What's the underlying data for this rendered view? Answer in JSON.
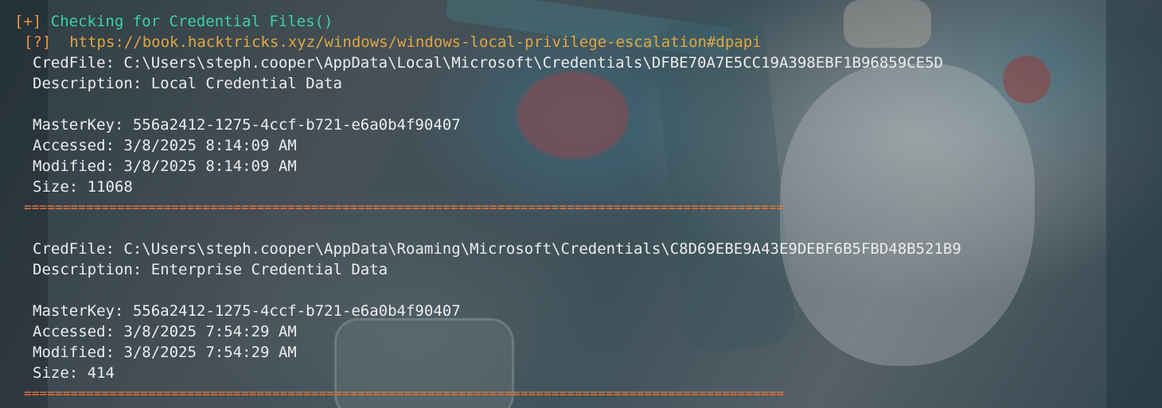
{
  "colors": {
    "orange": "#f0943a",
    "cyan": "#39d2a5",
    "yellow": "#e3a63d",
    "text": "#ececec",
    "separator": "#e8783a"
  },
  "header": {
    "plus_marker": "[+]",
    "check_title": "Checking for Credential Files()",
    "info_marker": "[?]",
    "info_link": "https://book.hacktricks.xyz/windows/windows-local-privilege-escalation#dpapi"
  },
  "entries": [
    {
      "credfile": "CredFile: C:\\Users\\steph.cooper\\AppData\\Local\\Microsoft\\Credentials\\DFBE70A7E5CC19A398EBF1B96859CE5D",
      "description": "Description: Local Credential Data",
      "masterkey": "MasterKey: 556a2412-1275-4ccf-b721-e6a0b4f90407",
      "accessed": "Accessed: 3/8/2025 8:14:09 AM",
      "modified": "Modified: 3/8/2025 8:14:09 AM",
      "size": "Size: 11068"
    },
    {
      "credfile": "CredFile: C:\\Users\\steph.cooper\\AppData\\Roaming\\Microsoft\\Credentials\\C8D69EBE9A43E9DEBF6B5FBD48B521B9",
      "description": "Description: Enterprise Credential Data",
      "masterkey": "MasterKey: 556a2412-1275-4ccf-b721-e6a0b4f90407",
      "accessed": "Accessed: 3/8/2025 7:54:29 AM",
      "modified": "Modified: 3/8/2025 7:54:29 AM",
      "size": "Size: 414"
    }
  ],
  "separator": "=================================================================================================="
}
